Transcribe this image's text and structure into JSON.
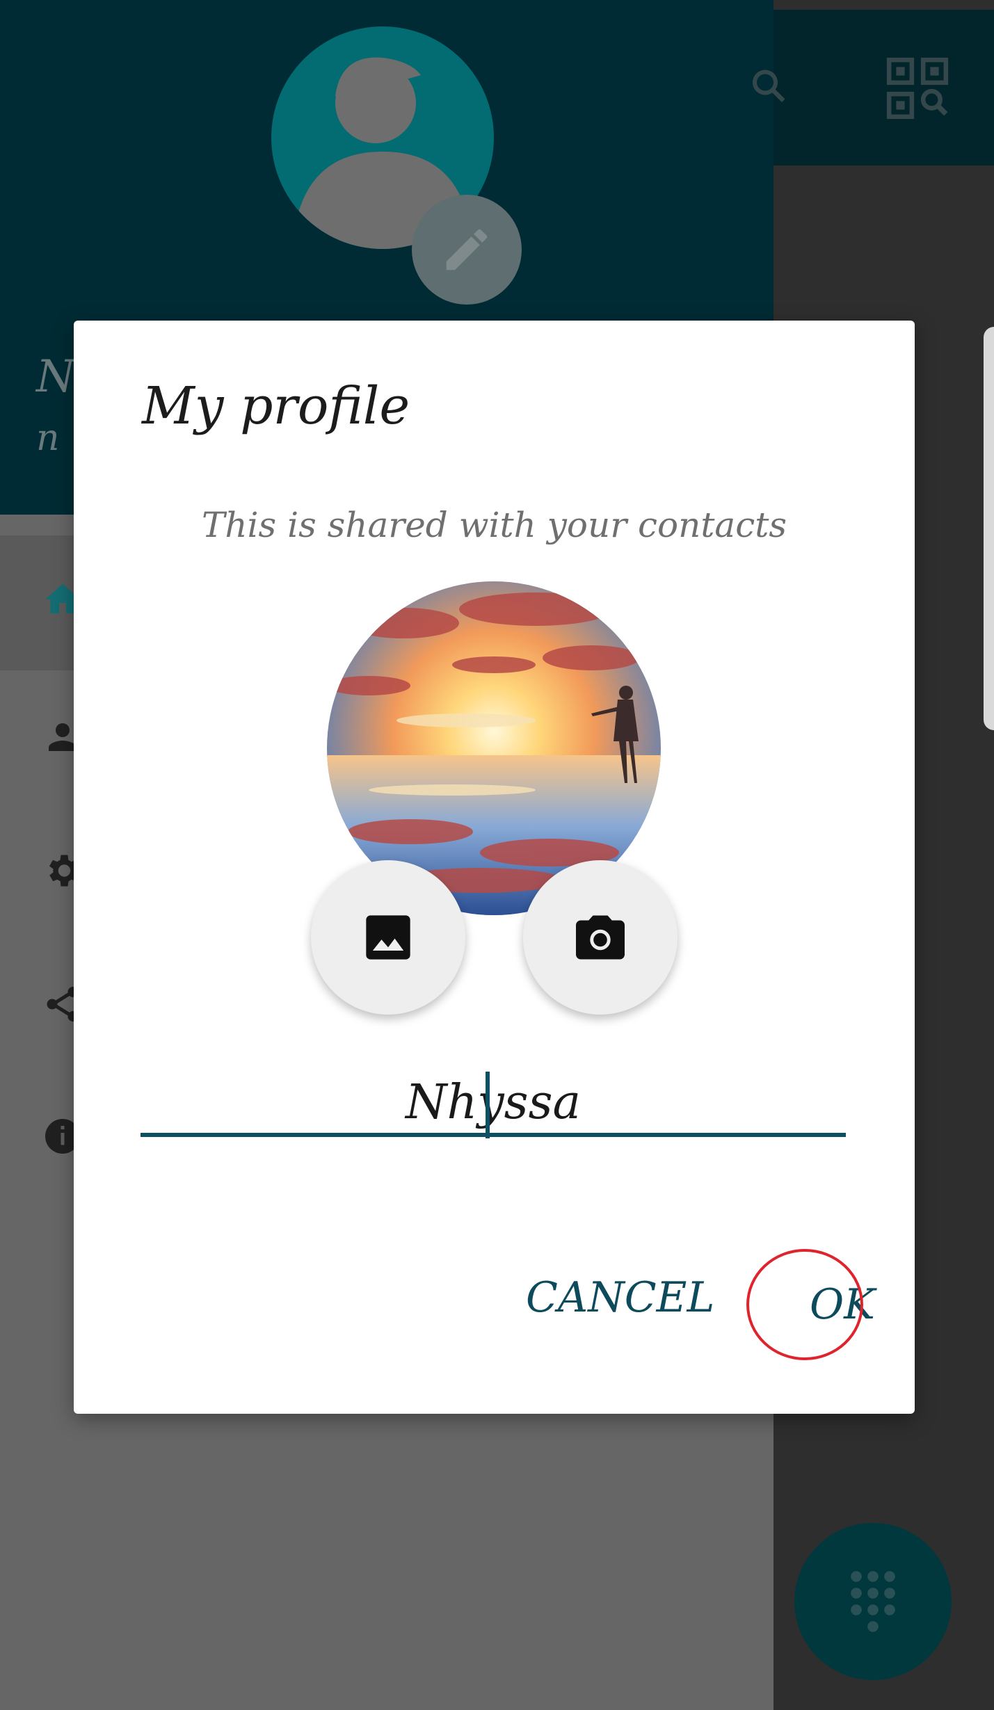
{
  "background": {
    "drawer": {
      "name": "N",
      "sub": "n",
      "items": [
        "home-icon",
        "person-icon",
        "settings-icon",
        "share-icon",
        "info-icon"
      ]
    },
    "toolbar_icons": [
      "search-icon",
      "qr-code-icon"
    ],
    "fab_icon": "dialpad-icon"
  },
  "dialog": {
    "title": "My profile",
    "subtitle": "This is shared with your contacts",
    "photo_buttons": [
      "image-icon",
      "camera-icon"
    ],
    "name_value": "Nhyssa",
    "cancel_label": "CANCEL",
    "ok_label": "OK",
    "accent_color": "#0d5064",
    "highlight_color": "#e0242d"
  }
}
